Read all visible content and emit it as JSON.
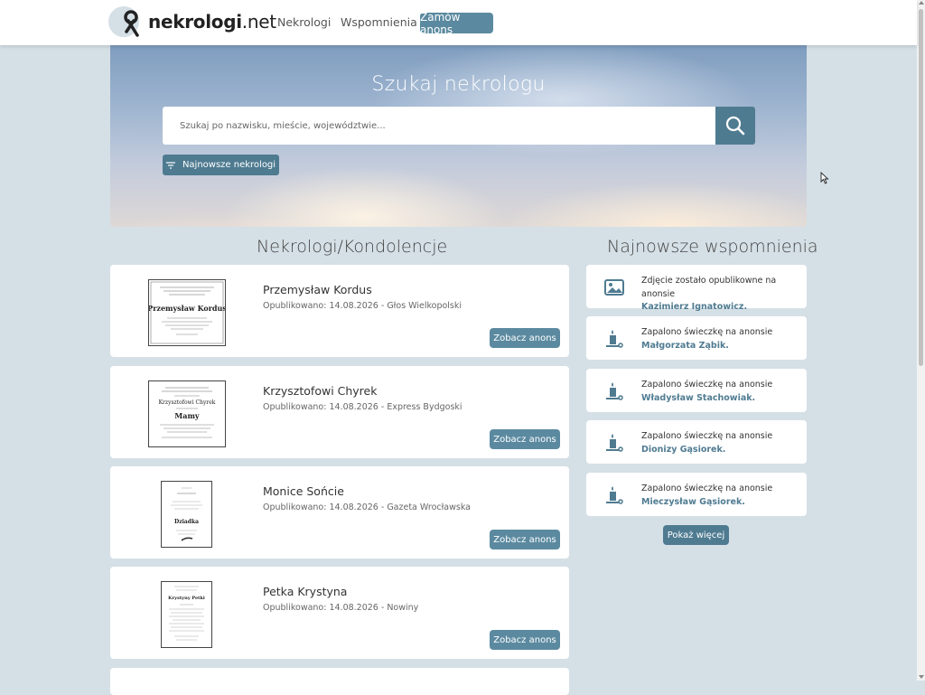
{
  "header": {
    "logo_bold": "nekrologi",
    "logo_suffix": ".net",
    "nav": [
      "Nekrologi",
      "Wspomnienia"
    ],
    "order_button": "Zamów anons"
  },
  "hero": {
    "title": "Szukaj nekrologu",
    "search_placeholder": "Szukaj po nazwisku, mieście, województwie...",
    "latest_button": "Najnowsze nekrologi"
  },
  "sections": {
    "obituaries_title": "Nekrologi/Kondolencje",
    "memories_title": "Najnowsze wspomnienia"
  },
  "obituaries": [
    {
      "name": "Przemysław Kordus",
      "published": "Opublikowano: 14.08.2026 - Głos Wielkopolski",
      "button": "Zobacz anons"
    },
    {
      "name": "Krzysztofowi Chyrek",
      "published": "Opublikowano: 14.08.2026 - Express Bydgoski",
      "button": "Zobacz anons"
    },
    {
      "name": "Monice Sońcie",
      "published": "Opublikowano: 14.08.2026 - Gazeta Wrocławska",
      "button": "Zobacz anons"
    },
    {
      "name": "Petka Krystyna",
      "published": "Opublikowano: 14.08.2026 - Nowiny",
      "button": "Zobacz anons"
    }
  ],
  "thumbs": {
    "t0_name": "Przemysław Kordus",
    "t1_name": "Krzysztofowi Chyrek",
    "t1_word": "Mamy",
    "t2_word": "Dziadka",
    "t3_name": "Krystyny Petki"
  },
  "memories": [
    {
      "icon": "image-icon",
      "text": "Zdjęcie zostało opublikowne na anonsie",
      "person": "Kazimierz Ignatowicz."
    },
    {
      "icon": "candle-icon",
      "text": "Zapalono świeczkę na anonsie",
      "person": "Małgorzata Ząbik."
    },
    {
      "icon": "candle-icon",
      "text": "Zapalono świeczkę na anonsie",
      "person": "Władysław Stachowiak."
    },
    {
      "icon": "candle-icon",
      "text": "Zapalono świeczkę na anonsie",
      "person": "Dionizy Gąsiorek."
    },
    {
      "icon": "candle-icon",
      "text": "Zapalono świeczkę na anonsie",
      "person": "Mieczysław Gąsiorek."
    }
  ],
  "more_button": "Pokaż więcej",
  "colors": {
    "accent": "#4f7b91",
    "button": "#5b8aa0",
    "background": "#d5e0e6"
  }
}
